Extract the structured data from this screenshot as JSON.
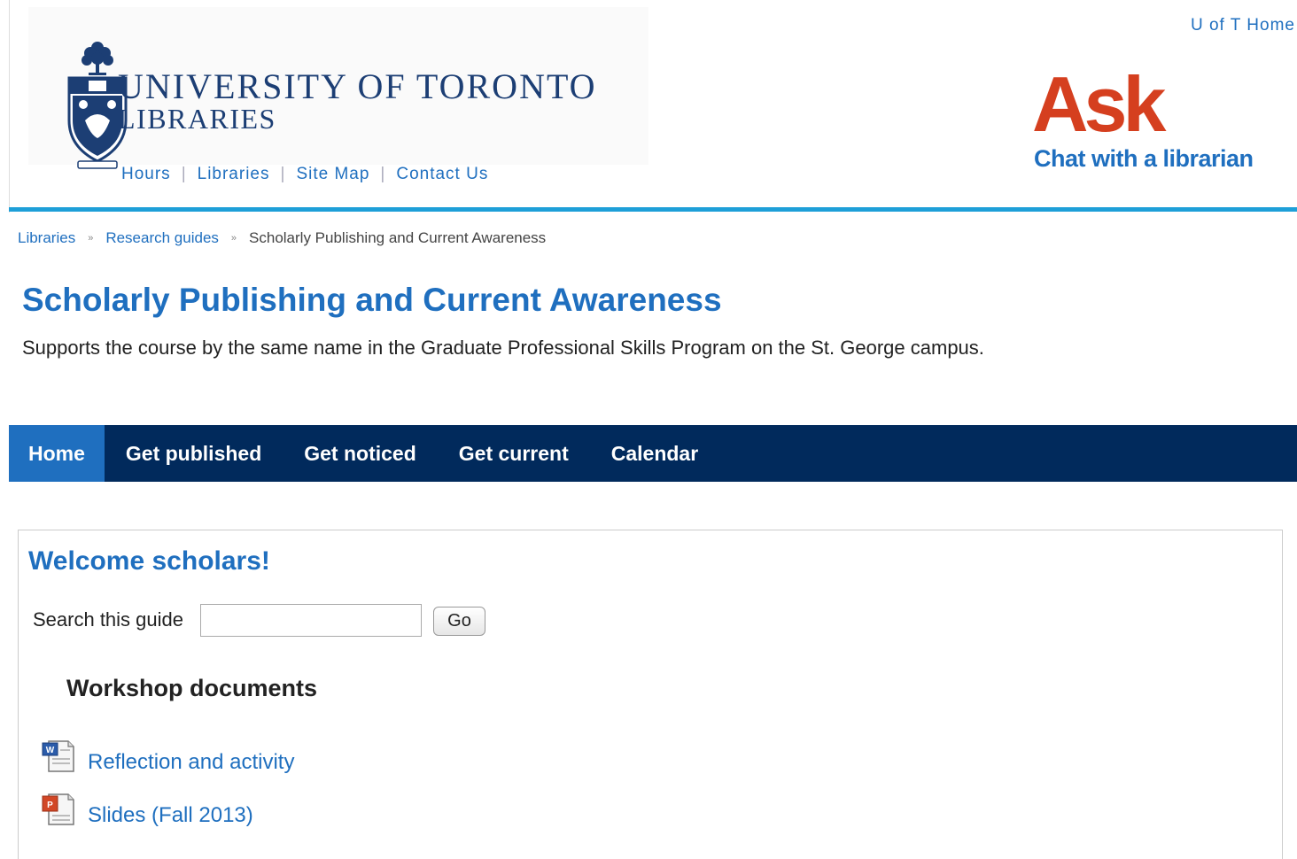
{
  "header": {
    "logo_title": "UNIVERSITY OF TORONTO",
    "logo_subtitle": "LIBRARIES",
    "uoft_home": "U of T Home",
    "nav": [
      "Hours",
      "Libraries",
      "Site Map",
      "Contact Us"
    ],
    "ask_word": "Ask",
    "ask_sub": "Chat with a librarian"
  },
  "breadcrumb": {
    "items": [
      "Libraries",
      "Research guides"
    ],
    "current": "Scholarly Publishing and Current Awareness"
  },
  "page": {
    "title": "Scholarly Publishing and Current Awareness",
    "description": "Supports the course by the same name in the Graduate Professional Skills Program on the St. George campus."
  },
  "tabs": [
    {
      "label": "Home",
      "active": true
    },
    {
      "label": "Get published"
    },
    {
      "label": "Get noticed"
    },
    {
      "label": "Get current"
    },
    {
      "label": "Calendar"
    }
  ],
  "main": {
    "box_title": "Welcome scholars!",
    "search_label": "Search this guide",
    "search_value": "",
    "go_label": "Go",
    "section_heading": "Workshop documents",
    "documents": [
      {
        "label": "Reflection and activity",
        "icon": "word-document-icon"
      },
      {
        "label": "Slides (Fall 2013)",
        "icon": "powerpoint-document-icon"
      }
    ]
  },
  "colors": {
    "link": "#1f6fbf",
    "nav_bar": "#012a5c",
    "active_tab": "#1f6fbf",
    "accent_rule": "#1e9fd8",
    "ask_red": "#d53f1f",
    "logo_navy": "#1c3e74"
  }
}
